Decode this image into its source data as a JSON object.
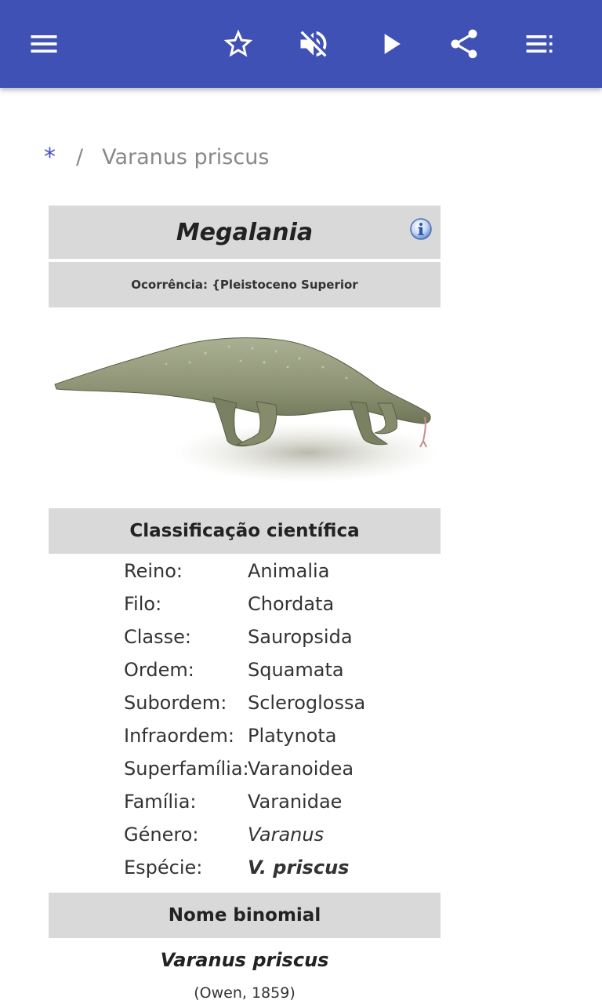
{
  "toolbar": {
    "icons": [
      "menu-icon",
      "star-outline-icon",
      "volume-off-icon",
      "play-icon",
      "share-icon",
      "playlist-icon"
    ],
    "color": "#3f51b5"
  },
  "breadcrumb": {
    "home": "*",
    "separator": "/",
    "current": "Varanus priscus"
  },
  "infobox": {
    "title": "Megalania",
    "occurrence": "Ocorrência: {Pleistoceno Superior",
    "classification_header": "Classificação científica",
    "taxonomy": [
      {
        "rank": "Reino:",
        "value": "Animalia"
      },
      {
        "rank": "Filo:",
        "value": "Chordata"
      },
      {
        "rank": "Classe:",
        "value": "Sauropsida"
      },
      {
        "rank": "Ordem:",
        "value": "Squamata"
      },
      {
        "rank": "Subordem:",
        "value": "Scleroglossa"
      },
      {
        "rank": "Infraordem:",
        "value": "Platynota"
      },
      {
        "rank": "Superfamília:",
        "value": "Varanoidea"
      },
      {
        "rank": "Família:",
        "value": "Varanidae"
      },
      {
        "rank": "Género:",
        "value": "Varanus"
      },
      {
        "rank": "Espécie:",
        "value": "V. priscus"
      }
    ],
    "binomial_header": "Nome binomial",
    "binomial_name": "Varanus priscus",
    "binomial_authority": "(Owen, 1859)",
    "header_bg": "#d9d9d9"
  }
}
